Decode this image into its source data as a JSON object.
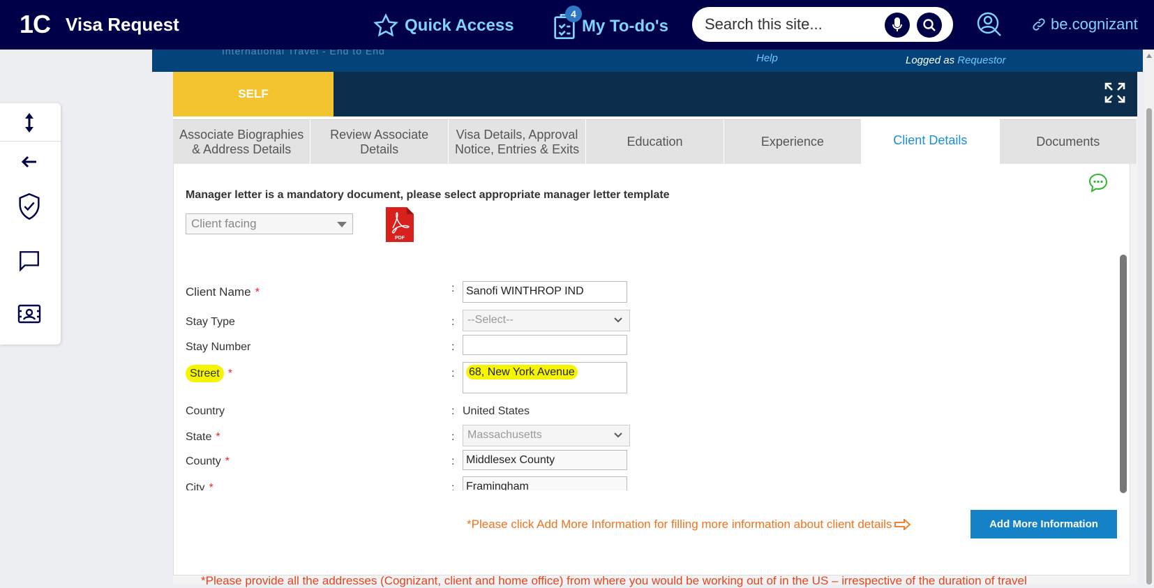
{
  "nav": {
    "logo": "1C",
    "app_title": "Visa Request",
    "quick_access": "Quick Access",
    "todos": "My To-do's",
    "todo_count": "4",
    "search_placeholder": "Search this site...",
    "link": "be.cognizant"
  },
  "subheader": {
    "faded_title": "International Travel - End to End",
    "help": "Help",
    "logged_prefix": "Logged as",
    "role": "Requestor"
  },
  "panel": {
    "self_tab": "SELF",
    "tabs": [
      "Associate Biographies & Address Details",
      "Review Associate Details",
      "Visa Details, Approval Notice, Entries & Exits",
      "Education",
      "Experience",
      "Client Details",
      "Documents"
    ],
    "active_tab": "Client Details"
  },
  "manager_letter": {
    "text": "Manager letter is a mandatory document, please select appropriate manager letter template",
    "template_value": "Client facing",
    "pdf_label": "PDF"
  },
  "form": {
    "client_name_label": "Client Name",
    "client_name_value": "Sanofi WINTHROP IND",
    "stay_type_label": "Stay Type",
    "stay_type_value": "--Select--",
    "stay_number_label": "Stay Number",
    "stay_number_value": "",
    "street_label": "Street",
    "street_value": "68, New York Avenue",
    "country_label": "Country",
    "country_value": "United States",
    "state_label": "State",
    "state_value": "Massachusetts",
    "county_label": "County",
    "county_value": "Middlesex County",
    "city_label": "City",
    "city_value": "Framingham",
    "required_mark": "*",
    "colon": ":"
  },
  "info_message": "*Please click Add More Information for filling more information about client details",
  "add_more_label": "Add More Information",
  "bottom_message": "*Please provide all the addresses (Cognizant, client and home office) from where you would be working out of in the US – irrespective of the duration of travel",
  "colors": {
    "nav_bg": "#000048",
    "accent_cyan": "#7fd3ff",
    "self_yellow": "#f4c430",
    "active_tab_blue": "#1a8fd6",
    "button_blue": "#1582c7",
    "warning_orange": "#f0731e",
    "highlight": "#f5f500"
  }
}
